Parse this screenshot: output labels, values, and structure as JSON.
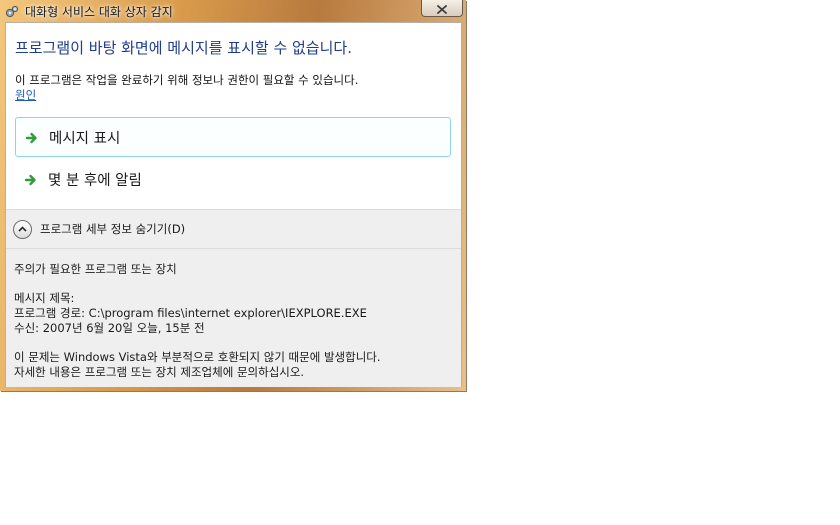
{
  "window": {
    "title": "대화형 서비스 대화 상자 감지",
    "close_label": "x"
  },
  "dialog": {
    "headline": "프로그램이 바탕 화면에 메시지를 표시할 수 없습니다.",
    "subtext": "이 프로그램은 작업을 완료하기 위해 정보나 권한이 필요할 수 있습니다.",
    "reason_link": "원인"
  },
  "commands": [
    {
      "label": "메시지 표시"
    },
    {
      "label": "몇 분 후에 알림"
    }
  ],
  "details": {
    "toggle_label": "프로그램 세부 정보 숨기기(D)",
    "heading": "주의가 필요한 프로그램 또는 장치",
    "message_title": "메시지 제목:",
    "program_path": "프로그램 경로:  C:\\program files\\internet explorer\\IEXPLORE.EXE",
    "received": "수신:  2007년 6월 20일 오늘, 15분 전",
    "note1": "이 문제는 Windows Vista와 부분적으로 호환되지 않기 때문에 발생합니다.",
    "note2": "자세한 내용은 프로그램 또는 장치 제조업체에 문의하십시오."
  },
  "colors": {
    "headline": "#1f3d8c",
    "link": "#1d5ab5",
    "arrow": "#2e9e3a",
    "selected_border": "#8fd6de"
  },
  "icons": {
    "title": "gears-icon",
    "command": "green-arrow-icon",
    "toggle": "chevron-up-icon"
  }
}
